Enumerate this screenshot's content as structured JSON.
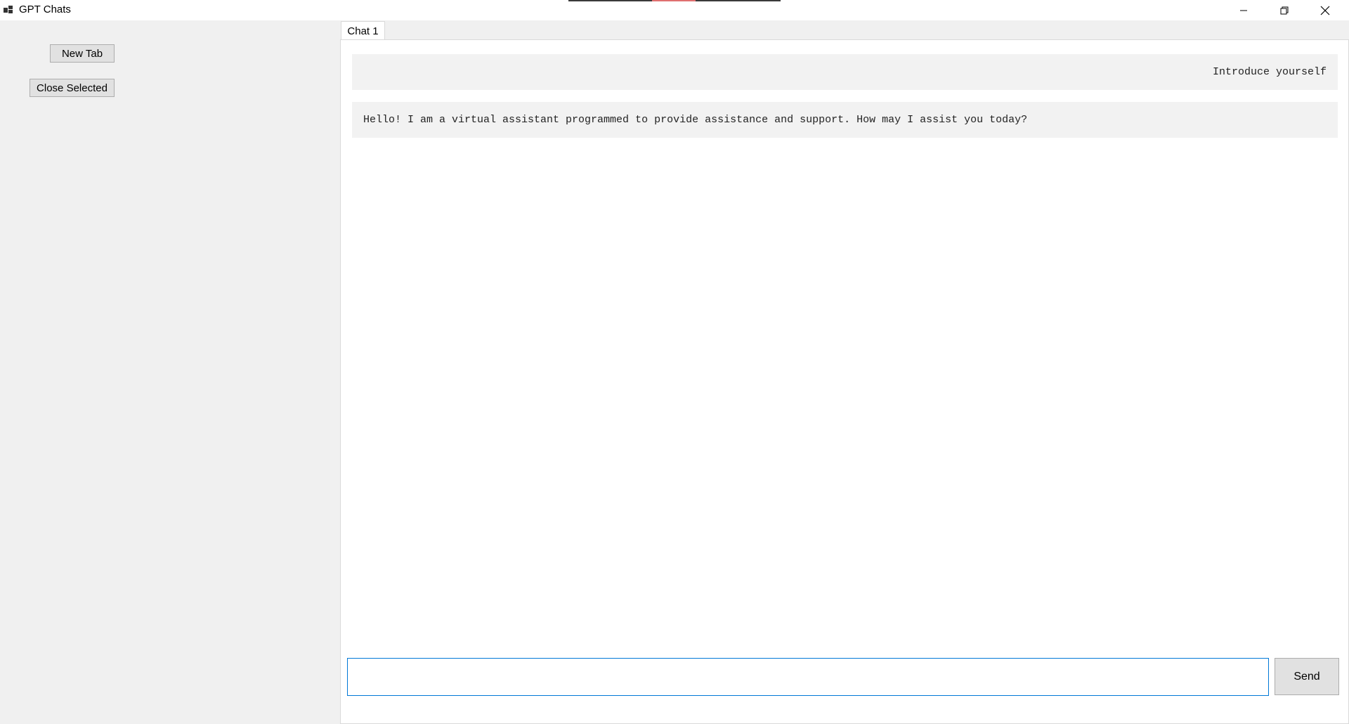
{
  "window": {
    "title": "GPT Chats",
    "controls": {
      "minimize_icon": "minimize-icon",
      "maximize_icon": "restore-icon",
      "close_icon": "close-icon"
    }
  },
  "sidebar": {
    "new_tab_label": "New Tab",
    "close_selected_label": "Close Selected"
  },
  "tabs": [
    {
      "label": "Chat 1",
      "selected": true
    }
  ],
  "chat": {
    "messages": [
      {
        "role": "user",
        "text": "Introduce yourself"
      },
      {
        "role": "assistant",
        "text": "Hello! I am a virtual assistant programmed to provide assistance and support. How may I assist you today?"
      }
    ],
    "input_value": "",
    "send_label": "Send"
  },
  "colors": {
    "accent": "#0078d7",
    "bubble": "#f2f2f2",
    "background": "#f0f0f0"
  }
}
